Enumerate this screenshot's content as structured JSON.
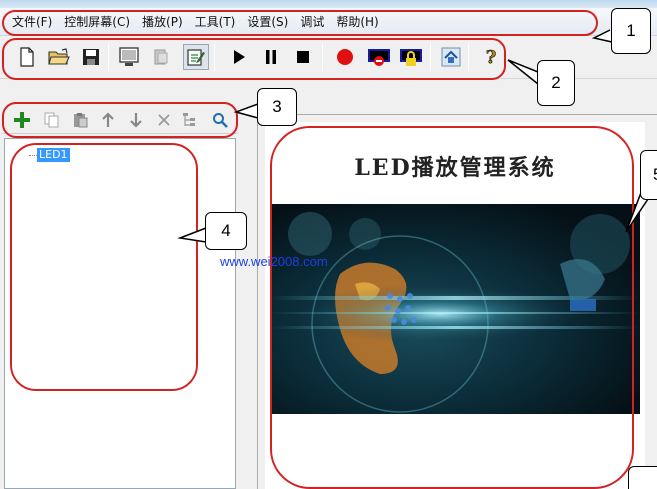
{
  "menu": {
    "items": [
      {
        "label": "文件(F)"
      },
      {
        "label": "控制屏幕(C)"
      },
      {
        "label": "播放(P)"
      },
      {
        "label": "工具(T)"
      },
      {
        "label": "设置(S)"
      },
      {
        "label": "调试"
      },
      {
        "label": "帮助(H)"
      }
    ]
  },
  "toolbar": {
    "icons": [
      "new-file-icon",
      "open-folder-icon",
      "save-icon",
      "display-icon",
      "send-icon",
      "edit-icon",
      "play-icon",
      "pause-icon",
      "stop-icon",
      "record-icon",
      "close-screen-icon",
      "lock-icon",
      "home-icon",
      "help-icon"
    ]
  },
  "tree_toolbar": {
    "icons": [
      "add-icon",
      "copy-icon",
      "paste-icon",
      "move-up-icon",
      "move-down-icon",
      "delete-icon",
      "tree-icon",
      "search-icon"
    ]
  },
  "tree": {
    "nodes": [
      {
        "label": "LED1"
      }
    ]
  },
  "preview": {
    "title": "LED播放管理系统"
  },
  "watermark": "www.wei2008.com",
  "callouts": {
    "labels": [
      "1",
      "2",
      "3",
      "4",
      "5"
    ]
  },
  "colors": {
    "callout_ring": "#d32222",
    "selection": "#3399ff",
    "watermark": "#1d3fe0"
  }
}
